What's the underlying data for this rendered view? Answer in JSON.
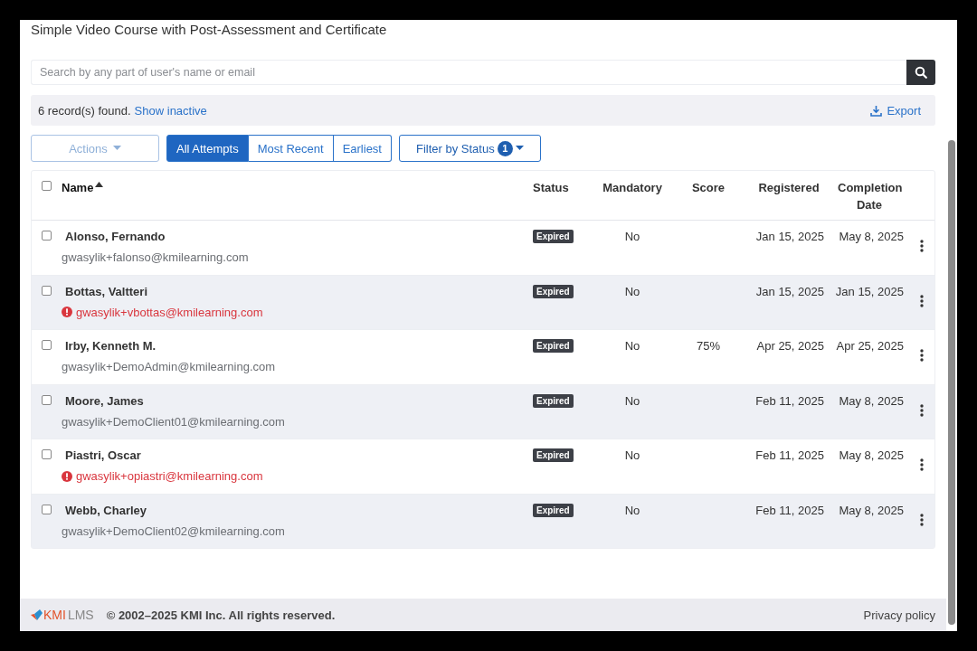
{
  "title": "Simple Video Course with Post-Assessment and Certificate",
  "search": {
    "placeholder": "Search by any part of user's name or email"
  },
  "records": {
    "count_text": "6 record(s) found.",
    "show_inactive": "Show inactive",
    "export": "Export"
  },
  "toolbar": {
    "actions": "Actions",
    "segments": [
      {
        "label": "All Attempts",
        "selected": true
      },
      {
        "label": "Most Recent",
        "selected": false
      },
      {
        "label": "Earliest",
        "selected": false
      }
    ],
    "filter": {
      "label": "Filter by Status",
      "badge": "1"
    }
  },
  "table": {
    "select_all_checked": false,
    "columns": [
      {
        "label": "Name",
        "sorted": true
      },
      {
        "label": "Status",
        "sorted": false
      },
      {
        "label": "Mandatory",
        "sorted": false
      },
      {
        "label": "Score",
        "sorted": false
      },
      {
        "label": "Registered",
        "sorted": false
      },
      {
        "label": "Completion Date",
        "sorted": false
      }
    ],
    "rows": [
      {
        "checked": false,
        "name": "Alonso, Fernando",
        "email": "gwasylik+falonso@kmilearning.com",
        "email_error": false,
        "status": "Expired",
        "mandatory": "No",
        "score": "",
        "registered": "Jan 15, 2025",
        "completion": "May 8, 2025"
      },
      {
        "checked": false,
        "name": "Bottas, Valtteri",
        "email": "gwasylik+vbottas@kmilearning.com",
        "email_error": true,
        "status": "Expired",
        "mandatory": "No",
        "score": "",
        "registered": "Jan 15, 2025",
        "completion": "Jan 15, 2025"
      },
      {
        "checked": false,
        "name": "Irby, Kenneth M.",
        "email": "gwasylik+DemoAdmin@kmilearning.com",
        "email_error": false,
        "status": "Expired",
        "mandatory": "No",
        "score": "75%",
        "registered": "Apr 25, 2025",
        "completion": "Apr 25, 2025"
      },
      {
        "checked": false,
        "name": "Moore, James",
        "email": "gwasylik+DemoClient01@kmilearning.com",
        "email_error": false,
        "status": "Expired",
        "mandatory": "No",
        "score": "",
        "registered": "Feb 11, 2025",
        "completion": "May 8, 2025"
      },
      {
        "checked": false,
        "name": "Piastri, Oscar",
        "email": "gwasylik+opiastri@kmilearning.com",
        "email_error": true,
        "status": "Expired",
        "mandatory": "No",
        "score": "",
        "registered": "Feb 11, 2025",
        "completion": "May 8, 2025"
      },
      {
        "checked": false,
        "name": "Webb, Charley",
        "email": "gwasylik+DemoClient02@kmilearning.com",
        "email_error": false,
        "status": "Expired",
        "mandatory": "No",
        "score": "",
        "registered": "Feb 11, 2025",
        "completion": "May 8, 2025"
      }
    ]
  },
  "footer": {
    "logo_brand": "KMI",
    "logo_product": "LMS",
    "copyright": "© 2002–2025 KMI Inc. All rights reserved.",
    "privacy": "Privacy policy"
  }
}
